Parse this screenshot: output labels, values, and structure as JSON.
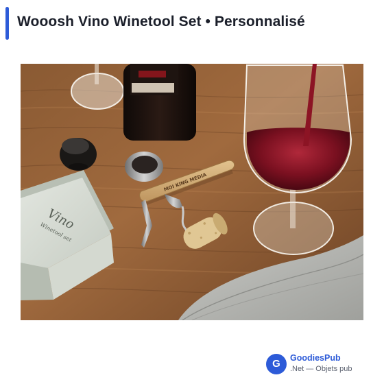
{
  "header": {
    "title": "Wooosh Vino Winetool Set • Personnalisé",
    "accent_color": "#2d5bd8"
  },
  "product_image": {
    "alt": "Wooosh Vino Winetool Set",
    "box_title": "Vino",
    "box_subtitle": "Winetool set",
    "engraving": "MOI KING MEDIA"
  },
  "brand": {
    "logo_letter": "G",
    "name": "GoodiesPub",
    "tagline": ".Net — Objets pub",
    "color": "#2d5bd8"
  }
}
